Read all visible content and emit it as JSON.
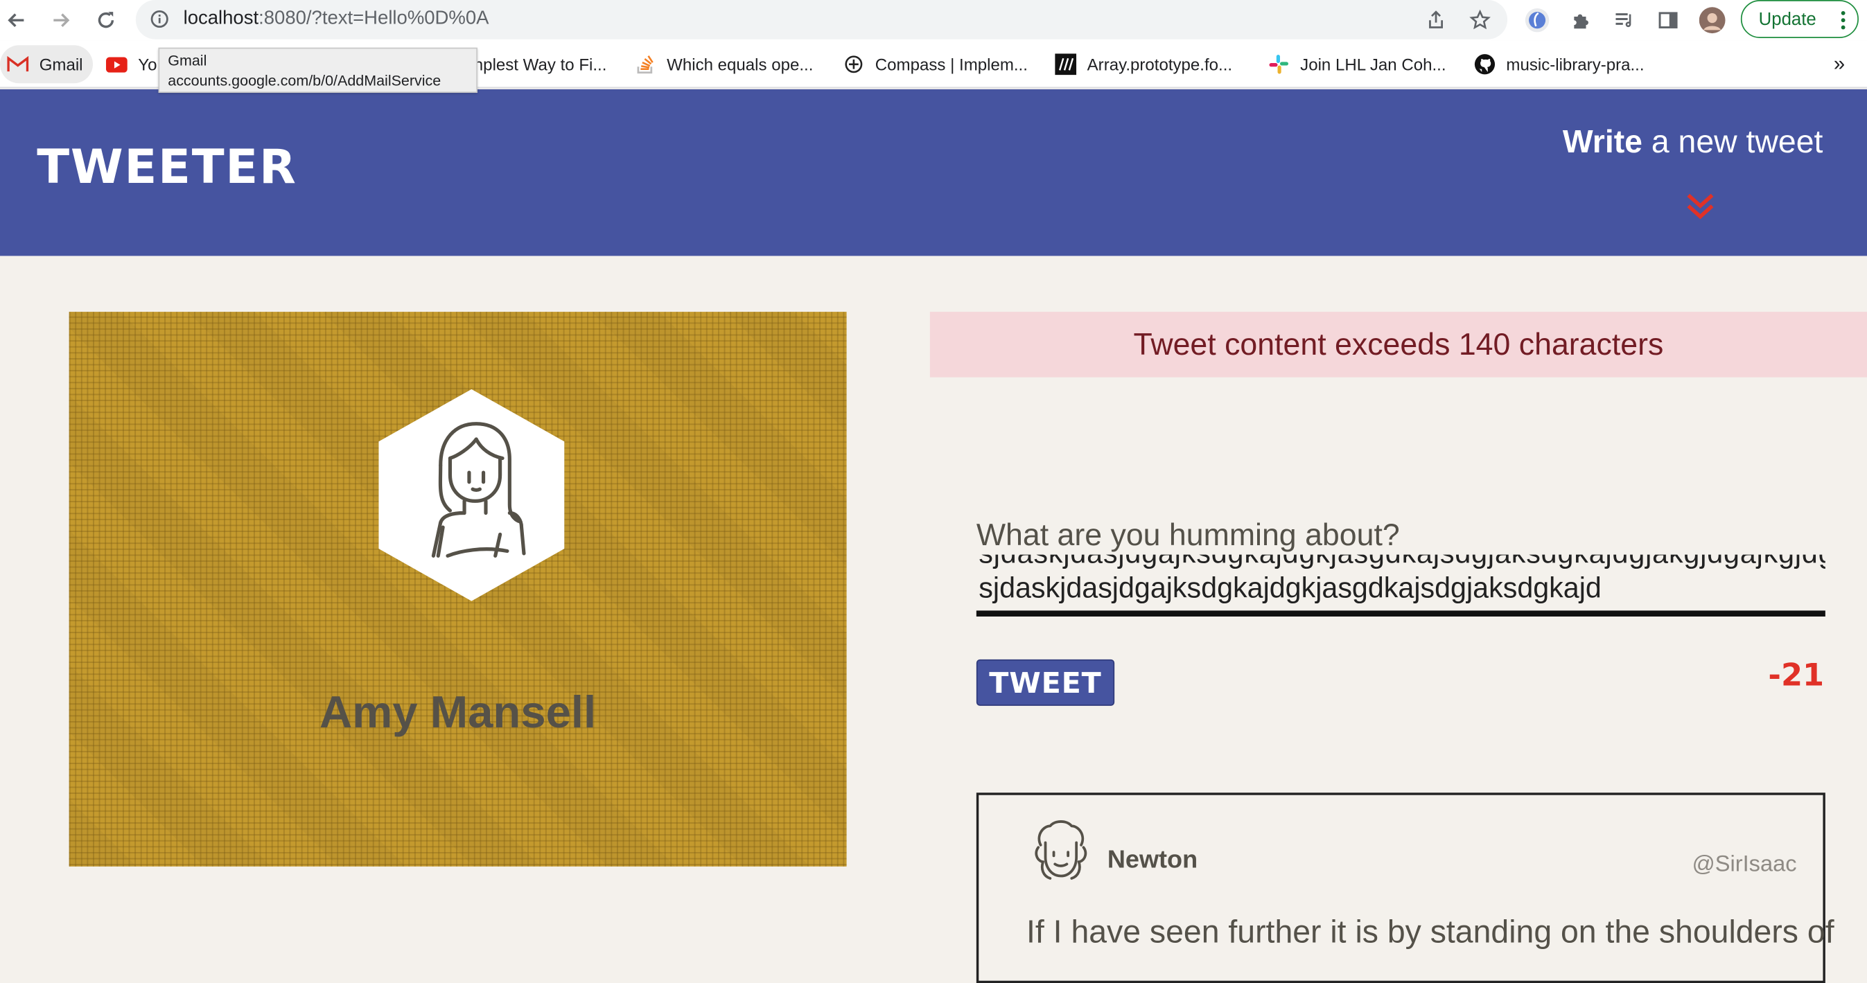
{
  "browser": {
    "url_host": "localhost",
    "url_rest": ":8080/?text=Hello%0D%0A",
    "update_label": "Update",
    "icons": [
      "back-arrow-icon",
      "forward-arrow-icon",
      "reload-icon",
      "info-icon",
      "share-icon",
      "star-icon",
      "extension-icon",
      "puzzle-icon",
      "reading-list-icon",
      "side-panel-icon",
      "profile-icon",
      "more-vert-icon"
    ]
  },
  "bookmarks": {
    "items": [
      {
        "label": "Gmail",
        "icon": "gmail-icon"
      },
      {
        "label": "Yo",
        "icon": "youtube-icon"
      },
      {
        "label": "nplest Way to Fi...",
        "icon": ""
      },
      {
        "label": "Which equals ope...",
        "icon": "stackoverflow-icon"
      },
      {
        "label": "Compass | Implem...",
        "icon": "compass-icon"
      },
      {
        "label": "Array.prototype.fo...",
        "icon": "mdn-icon"
      },
      {
        "label": "Join LHL Jan Coh...",
        "icon": "slack-icon"
      },
      {
        "label": "music-library-pra...",
        "icon": "github-icon"
      }
    ],
    "overflow": "»"
  },
  "tooltip": {
    "title": "Gmail",
    "url": "accounts.google.com/b/0/AddMailService"
  },
  "header": {
    "logo": "TWEETER",
    "write_bold": "Write",
    "write_rest": " a new tweet"
  },
  "profile": {
    "name": "Amy Mansell"
  },
  "compose": {
    "error": "Tweet content exceeds 140 characters",
    "label": "What are you humming about?",
    "text_prev_line": "sjdaskjdasjdgajksdgkajdgkjasgdkajsdgjaksdgkajdgjakgjdgajkgjdgajkg",
    "text_current_line": "sjdaskjdasjdgajksdgkajdgkjasgdkajsdgjaksdgkajd",
    "tweet_button": "TWEET",
    "counter": "-21"
  },
  "tweet": {
    "name": "Newton",
    "handle": "@SirIsaac",
    "content": "If I have seen further it is by standing on the shoulders of"
  },
  "colors": {
    "header_bg": "#4654a0",
    "page_bg": "#f4f1ec",
    "profile_bg": "#c49a2e",
    "error_bg": "#f5d7da",
    "error_text": "#721c24",
    "counter": "#e03127",
    "update_green": "#137333"
  }
}
